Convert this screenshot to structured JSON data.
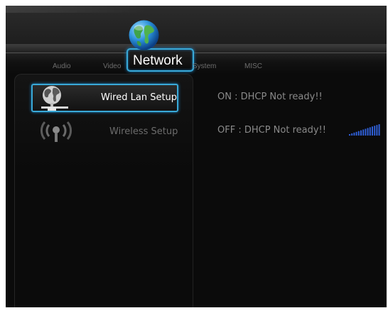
{
  "tabs": [
    "Audio",
    "Video",
    "Network",
    "System",
    "MISC"
  ],
  "active_tab": "Network",
  "menu": {
    "wired": {
      "label": "Wired Lan Setup",
      "icon": "wired-network-globe-icon",
      "selected": true
    },
    "wireless": {
      "label": "Wireless Setup",
      "icon": "wireless-signal-icon",
      "selected": false
    }
  },
  "status": {
    "wired": "ON : DHCP Not ready!!",
    "wireless": "OFF : DHCP Not ready!!"
  },
  "signal": {
    "bars": 14,
    "level": 1.0
  },
  "colors": {
    "background": "#0b0b0b",
    "accent": "#39a9d8",
    "signal": "#2f5fd6",
    "active_text": "#ffffff",
    "inactive_text": "#6c6c6c",
    "status_text": "#8a8a8a"
  }
}
